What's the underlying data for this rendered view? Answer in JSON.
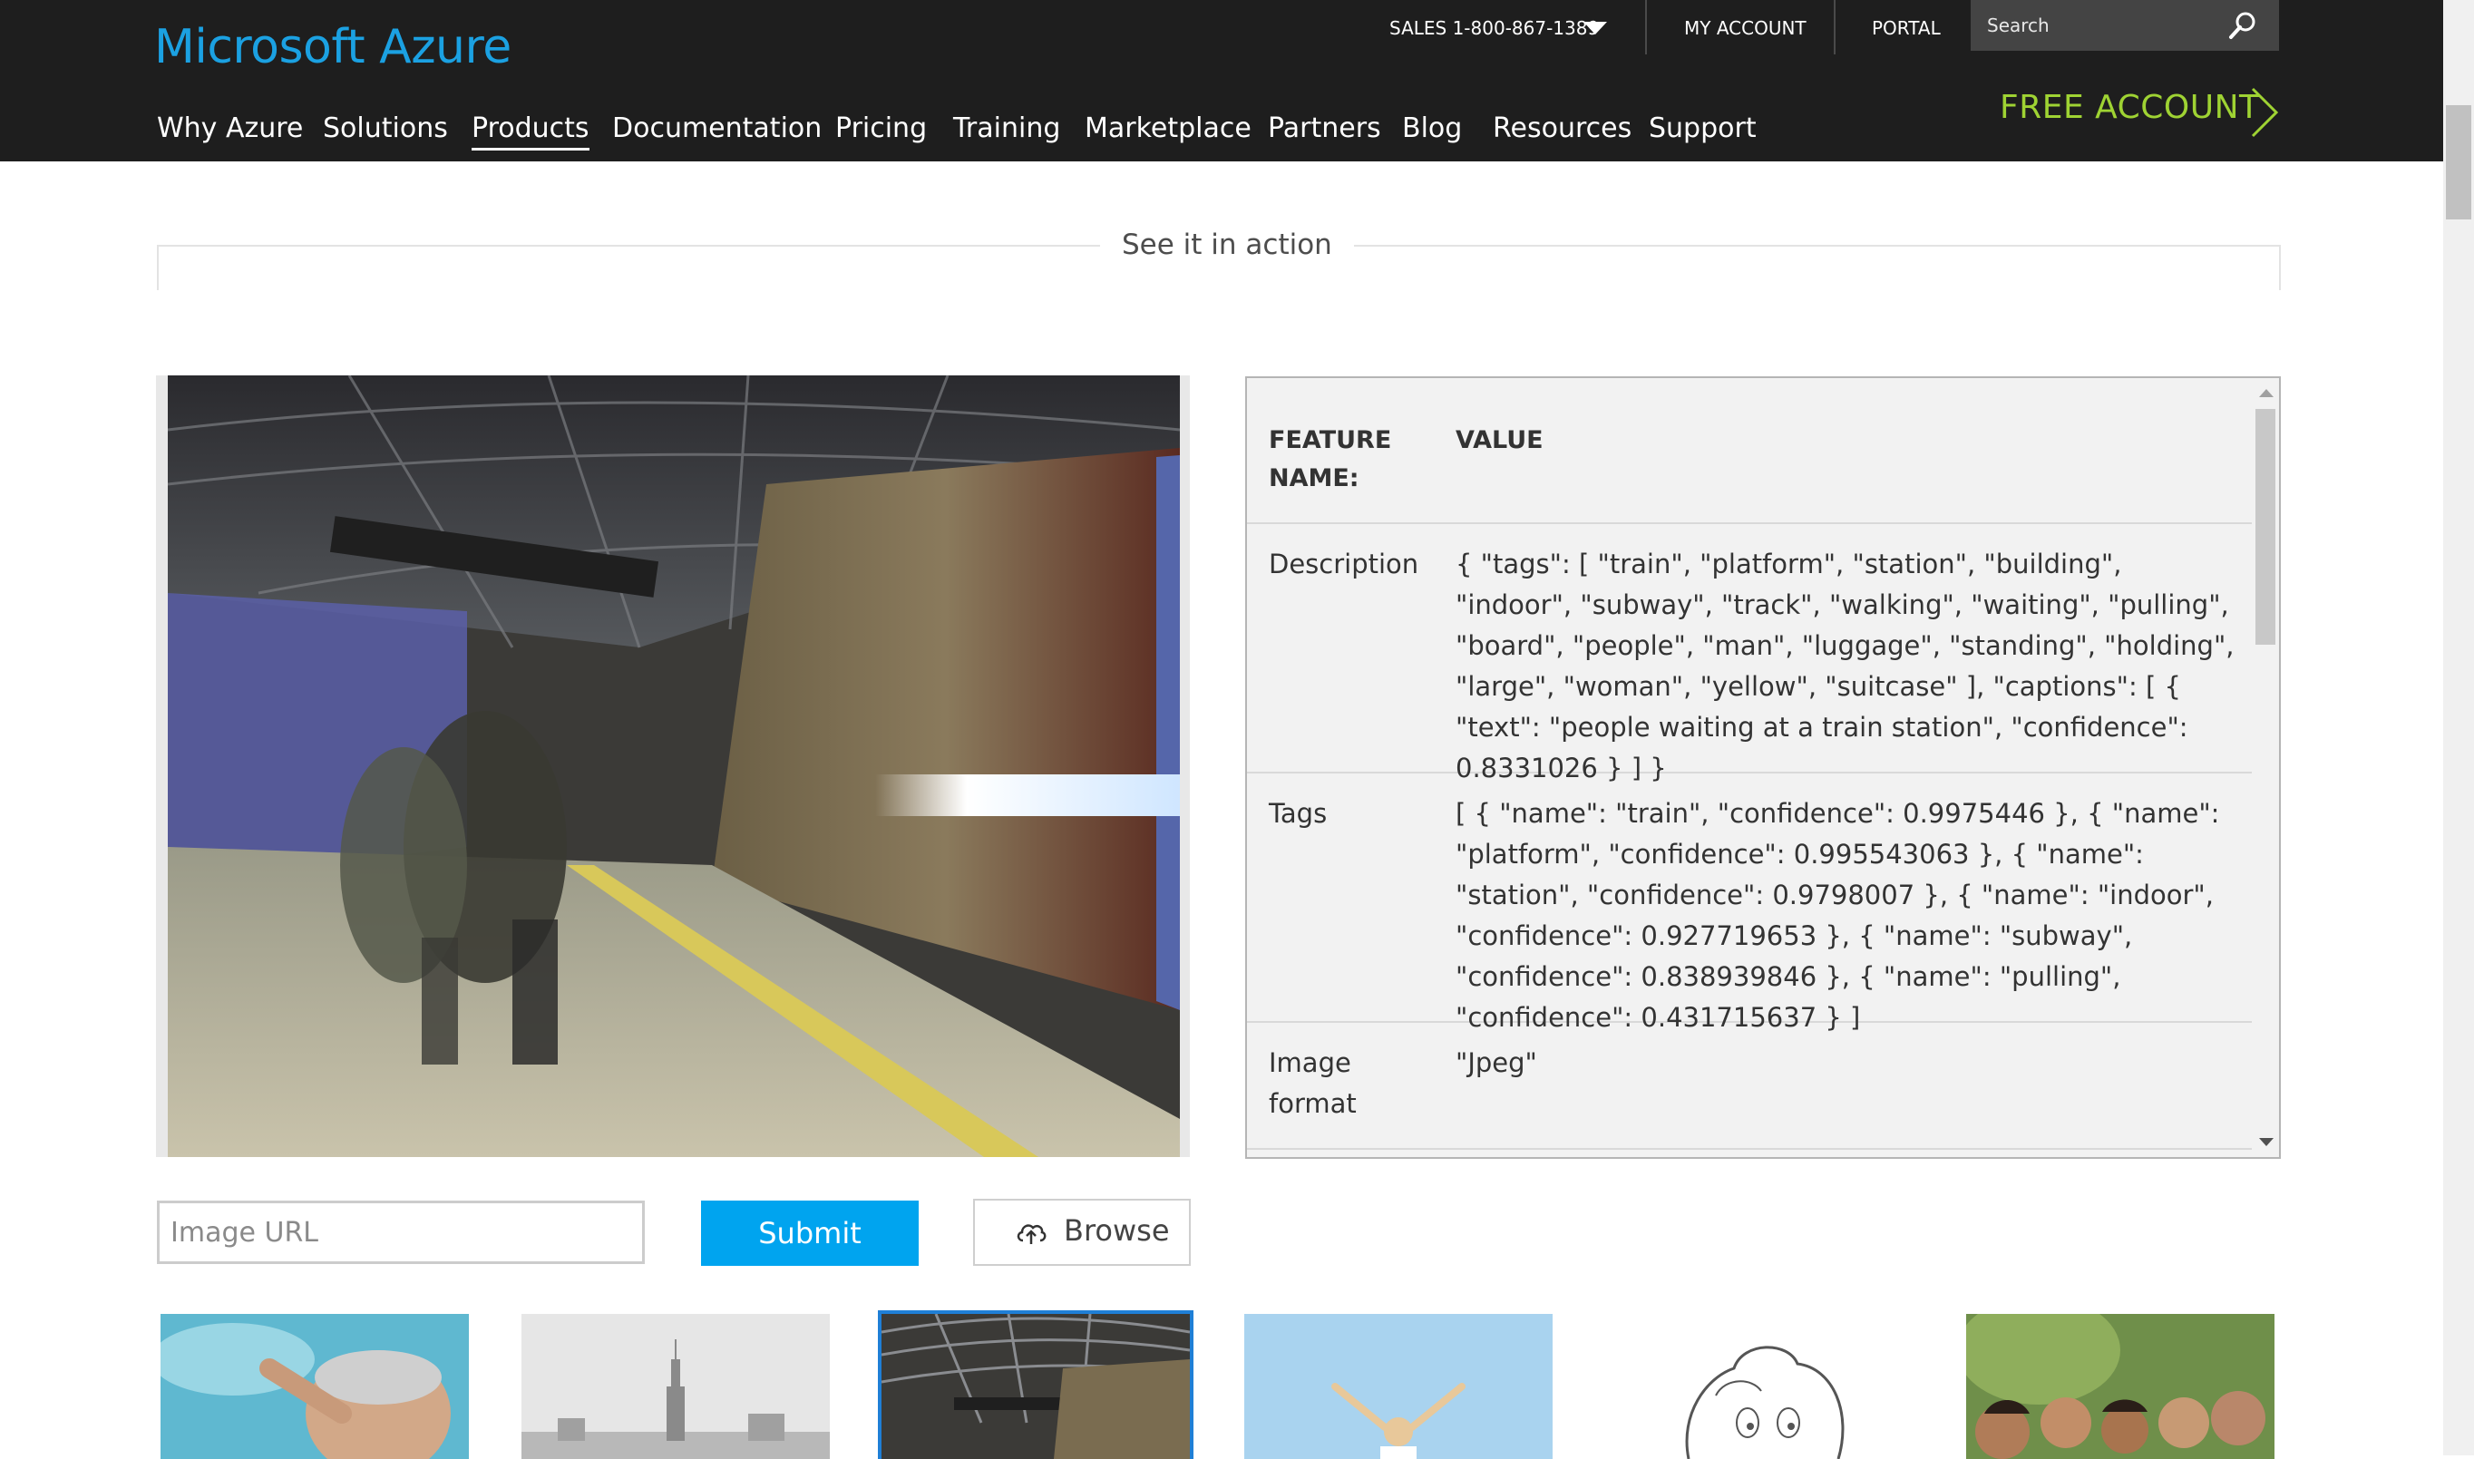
{
  "header": {
    "logo": "Microsoft Azure",
    "sales": "SALES 1-800-867-1389",
    "my_account": "MY ACCOUNT",
    "portal": "PORTAL",
    "search_placeholder": "Search",
    "free_account": "FREE ACCOUNT",
    "nav": [
      {
        "label": "Why Azure"
      },
      {
        "label": "Solutions"
      },
      {
        "label": "Products",
        "active": true
      },
      {
        "label": "Documentation"
      },
      {
        "label": "Pricing"
      },
      {
        "label": "Training"
      },
      {
        "label": "Marketplace"
      },
      {
        "label": "Partners"
      },
      {
        "label": "Blog"
      },
      {
        "label": "Resources"
      },
      {
        "label": "Support"
      }
    ]
  },
  "section": {
    "title": "See it in action"
  },
  "results": {
    "header": {
      "name": "FEATURE NAME:",
      "value": "VALUE"
    },
    "rows": [
      {
        "name": "Description",
        "value": "{ \"tags\": [ \"train\", \"platform\", \"station\", \"building\", \"indoor\", \"subway\", \"track\", \"walking\", \"waiting\", \"pulling\", \"board\", \"people\", \"man\", \"luggage\", \"standing\", \"holding\", \"large\", \"woman\", \"yellow\", \"suitcase\" ], \"captions\": [ { \"text\": \"people waiting at a train station\", \"confidence\": 0.8331026 } ] }"
      },
      {
        "name": "Tags",
        "value": "[ { \"name\": \"train\", \"confidence\": 0.9975446 }, { \"name\": \"platform\", \"confidence\": 0.995543063 }, { \"name\": \"station\", \"confidence\": 0.9798007 }, { \"name\": \"indoor\", \"confidence\": 0.927719653 }, { \"name\": \"subway\", \"confidence\": 0.838939846 }, { \"name\": \"pulling\", \"confidence\": 0.431715637 } ]"
      },
      {
        "name": "Image format",
        "value": "\"Jpeg\""
      }
    ]
  },
  "controls": {
    "url_placeholder": "Image URL",
    "submit": "Submit",
    "browse": "Browse"
  },
  "thumbnails": [
    {
      "icon": "swimmer-thumbnail"
    },
    {
      "icon": "city-skyline-thumbnail"
    },
    {
      "icon": "train-station-thumbnail",
      "selected": true
    },
    {
      "icon": "woman-celebrating-thumbnail"
    },
    {
      "icon": "cartoon-lion-thumbnail"
    },
    {
      "icon": "family-group-thumbnail"
    }
  ],
  "colors": {
    "header_bg": "#1e1e1e",
    "logo": "#1ba1e2",
    "free_account": "#9fd333",
    "submit_bg": "#00a4ef",
    "selected_outline": "#1f7fd6"
  }
}
